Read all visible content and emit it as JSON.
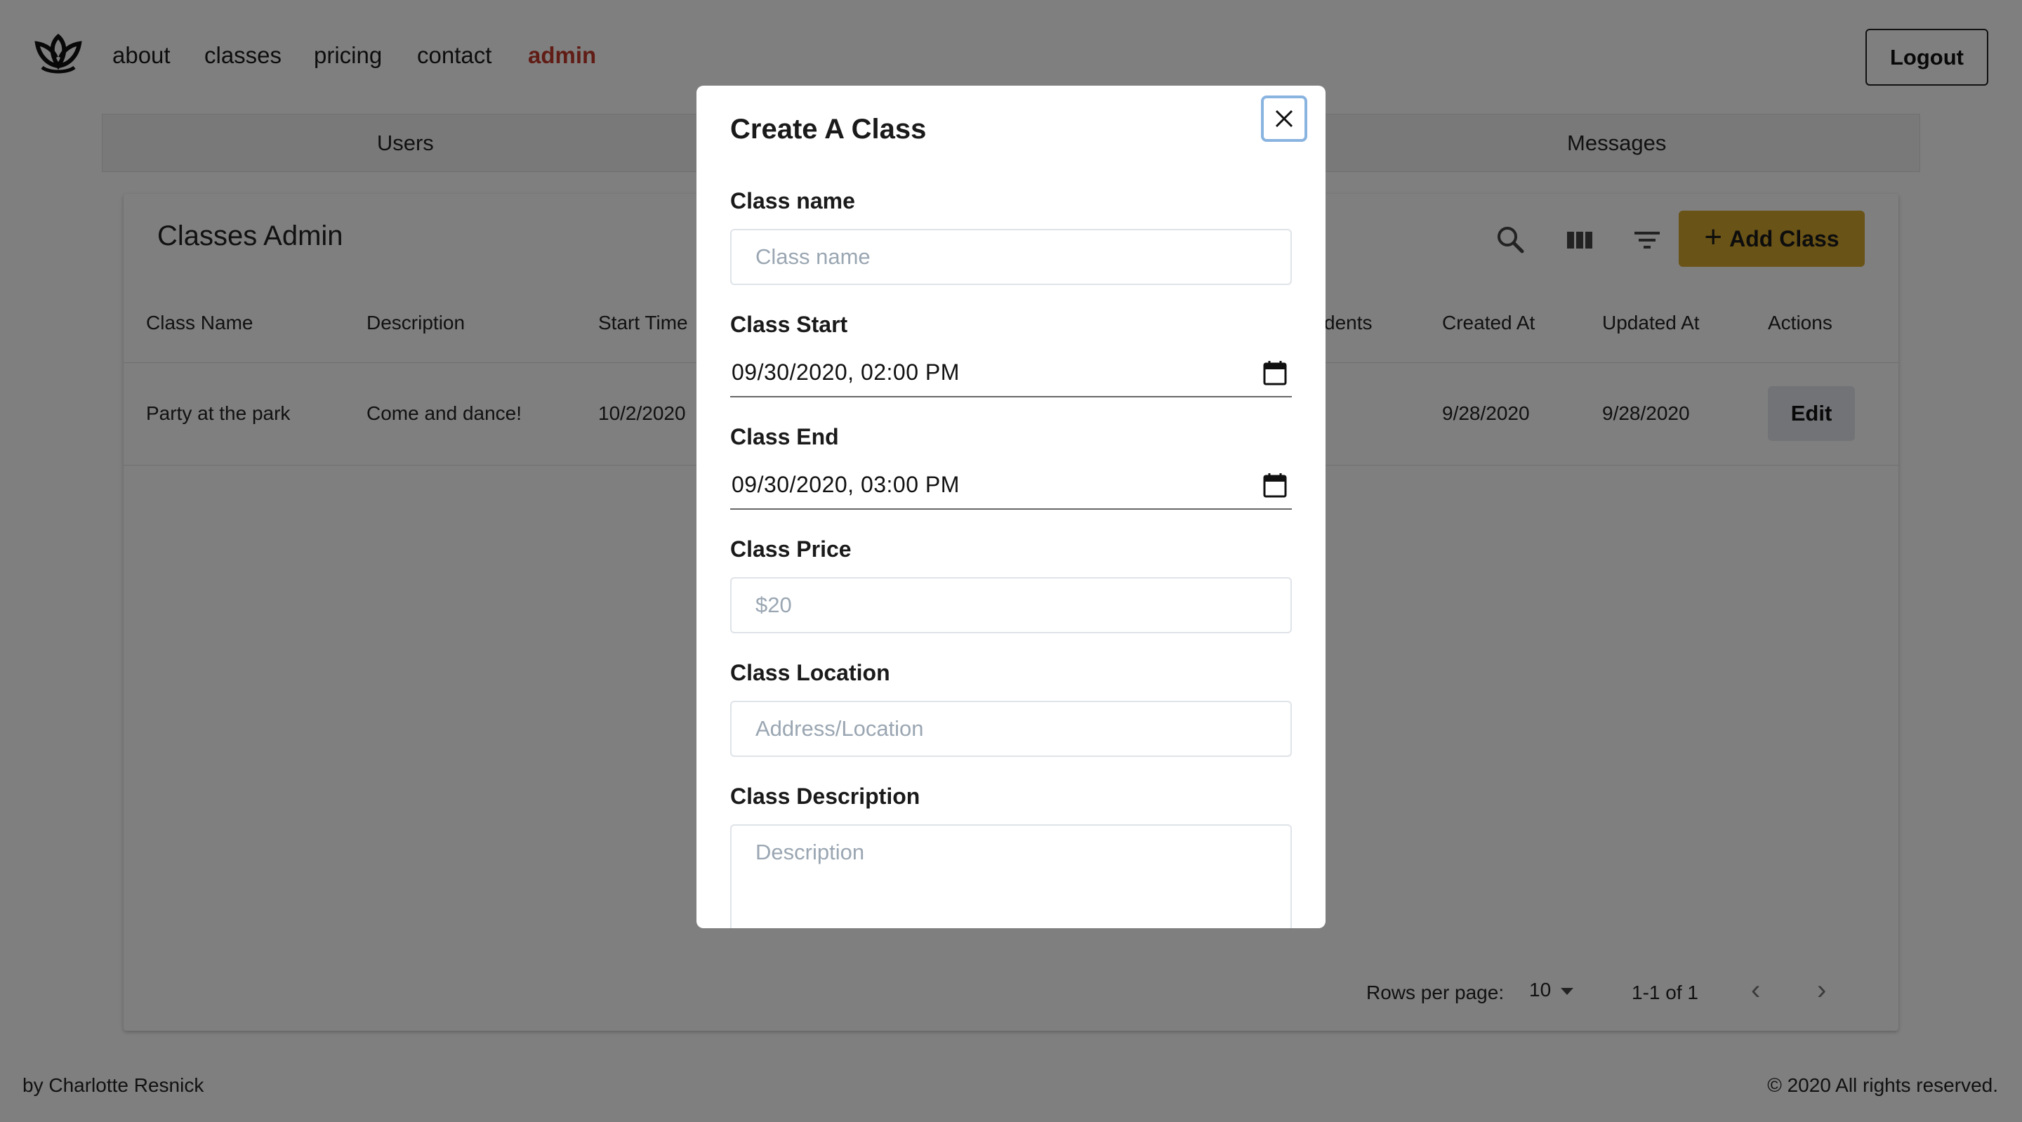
{
  "nav": {
    "links": [
      "about",
      "classes",
      "pricing",
      "contact",
      "admin"
    ],
    "active": "admin",
    "logout_label": "Logout"
  },
  "tabs": [
    "Users",
    "Messages"
  ],
  "admin": {
    "title": "Classes Admin",
    "add_label": "Add Class",
    "columns": [
      "Class Name",
      "Description",
      "Start Time",
      "dents",
      "Created At",
      "Updated At",
      "Actions"
    ],
    "rows": [
      {
        "class_name": "Party at the park",
        "description": "Come and dance!",
        "start_time": "10/2/2020",
        "created_at": "9/28/2020",
        "updated_at": "9/28/2020",
        "action_label": "Edit"
      }
    ],
    "pagination": {
      "rows_per_page_label": "Rows per page:",
      "rows_per_page": "10",
      "range": "1-1 of 1"
    }
  },
  "footer": {
    "left": "by Charlotte Resnick",
    "right": "© 2020 All rights reserved."
  },
  "modal": {
    "title": "Create A Class",
    "fields": {
      "name": {
        "label": "Class name",
        "placeholder": "Class name"
      },
      "start": {
        "label": "Class Start",
        "value": "09/30/2020, 02:00 PM"
      },
      "end": {
        "label": "Class End",
        "value": "09/30/2020, 03:00 PM"
      },
      "price": {
        "label": "Class Price",
        "placeholder": "$20"
      },
      "location": {
        "label": "Class Location",
        "placeholder": "Address/Location"
      },
      "description": {
        "label": "Class Description",
        "placeholder": "Description"
      }
    }
  },
  "colors": {
    "accent": "#d4a72c",
    "active_nav": "#c0392b",
    "overlay": "rgba(0,0,0,0.5)"
  }
}
